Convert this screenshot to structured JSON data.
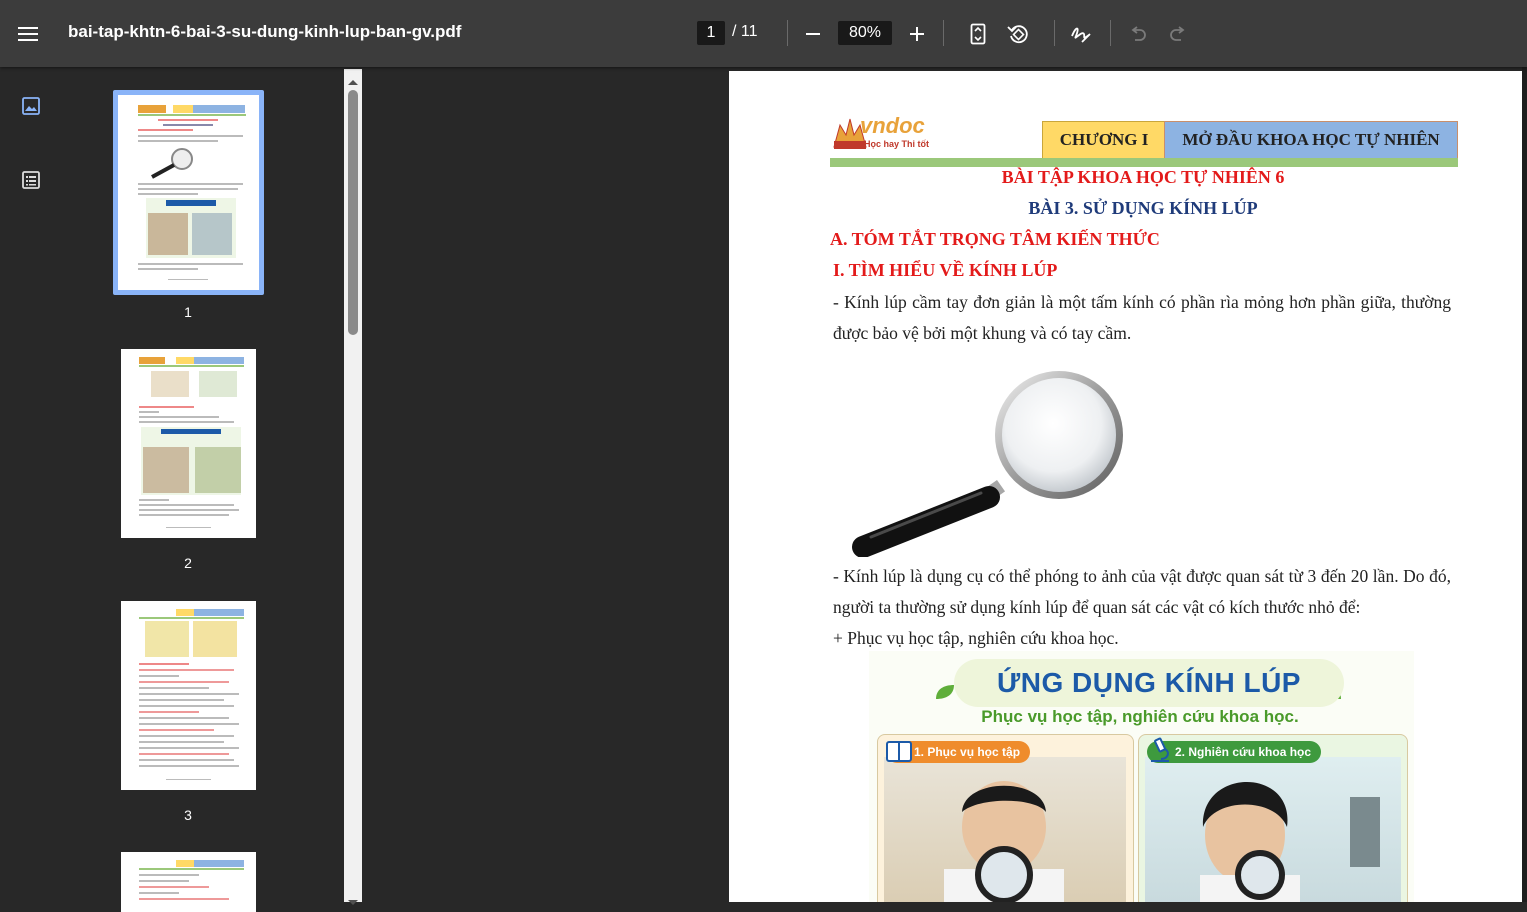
{
  "toolbar": {
    "menu_icon": "hamburger-menu-icon",
    "filename": "bai-tap-khtn-6-bai-3-su-dung-kinh-lup-ban-gv.pdf",
    "current_page": "1",
    "total_pages": "/ 11",
    "zoom": "80%",
    "icons": [
      "zoom-out-icon",
      "zoom-in-icon",
      "fit-page-icon",
      "rotate-icon",
      "annotate-icon",
      "undo-icon",
      "redo-icon"
    ]
  },
  "sidebar": {
    "view_icons": [
      "thumbnail-view-icon",
      "outline-view-icon"
    ],
    "thumbnails": [
      {
        "label": "1",
        "selected": true
      },
      {
        "label": "2",
        "selected": false
      },
      {
        "label": "3",
        "selected": false
      }
    ]
  },
  "document": {
    "logo_text": "vndoc",
    "logo_tagline": "Học hay Thi tốt",
    "chapter": "CHƯƠNG I",
    "chapter_title": "MỞ ĐẦU KHOA HỌC TỰ NHIÊN",
    "title": "BÀI TẬP KHOA HỌC TỰ NHIÊN 6",
    "lesson": "BÀI 3. SỬ DỤNG KÍNH LÚP",
    "section_a": "A. TÓM TẮT TRỌNG TÂM KIẾN THỨC",
    "section_1": "I. TÌM HIỂU VỀ KÍNH LÚP",
    "para1": "- Kính lúp cầm tay đơn giản là một tấm kính có phần rìa mỏng hơn phần giữa, thường được bảo vệ bởi một khung và có tay cầm.",
    "para2": "- Kính lúp là dụng cụ có thể phóng to ảnh của vật được quan sát từ 3 đến 20 lần. Do đó, người ta thường sử dụng kính lúp để quan sát các vật có kích thước nhỏ để:",
    "para3": "+ Phục vụ học tập, nghiên cứu khoa học.",
    "infographic": {
      "title": "ỨNG DỤNG KÍNH LÚP",
      "subtitle": "Phục vụ học tập, nghiên cứu khoa học.",
      "card1": "1. Phục vụ học tập",
      "card2": "2. Nghiên cứu khoa học"
    }
  },
  "colors": {
    "toolbar": "#3c3c3c",
    "background": "#282828",
    "selected_thumb": "#8ab4f8",
    "heading_red": "#e31a1a",
    "heading_navy": "#1f3b7a"
  }
}
